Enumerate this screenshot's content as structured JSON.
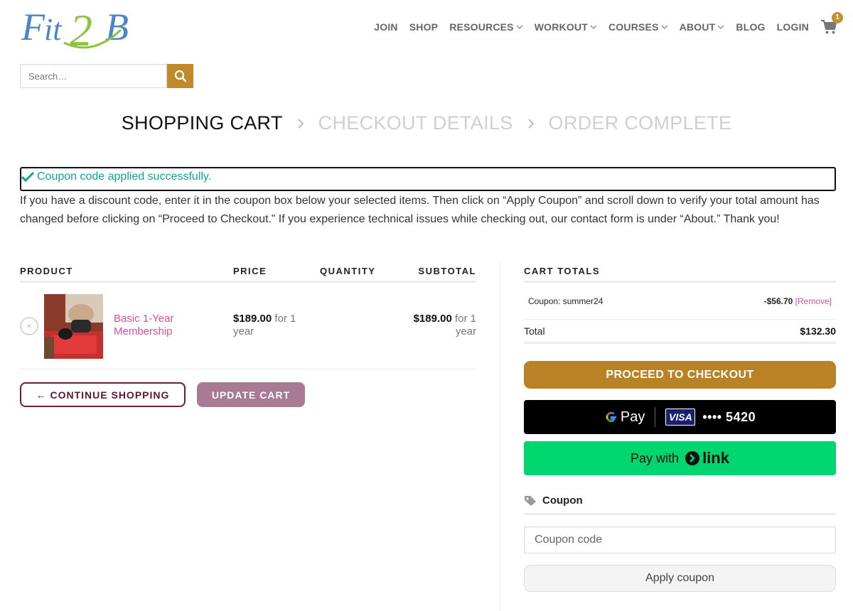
{
  "header": {
    "logo_text": "Fit2B",
    "nav": [
      {
        "label": "JOIN",
        "has_dropdown": false
      },
      {
        "label": "SHOP",
        "has_dropdown": false
      },
      {
        "label": "RESOURCES",
        "has_dropdown": true
      },
      {
        "label": "WORKOUT",
        "has_dropdown": true
      },
      {
        "label": "COURSES",
        "has_dropdown": true
      },
      {
        "label": "ABOUT",
        "has_dropdown": true
      },
      {
        "label": "BLOG",
        "has_dropdown": false
      },
      {
        "label": "LOGIN",
        "has_dropdown": false
      }
    ],
    "cart_count": "1",
    "cart_icon": "cart-icon"
  },
  "search": {
    "placeholder": "Search…",
    "icon": "search-icon"
  },
  "steps": [
    {
      "label": "SHOPPING CART",
      "active": true
    },
    {
      "label": "CHECKOUT DETAILS",
      "active": false
    },
    {
      "label": "ORDER COMPLETE",
      "active": false
    }
  ],
  "notice": {
    "text": "Coupon code applied successfully.",
    "icon": "check-icon",
    "color": "#11a58a"
  },
  "intro_text": "If you have a discount code, enter it in the coupon box below your selected items. Then click on “Apply Coupon” and scroll down to verify your total amount has changed before clicking on “Proceed to Checkout.” If you experience technical issues while checking out, our contact form is under “About.” Thank you!",
  "cart": {
    "headers": {
      "product": "PRODUCT",
      "price": "PRICE",
      "quantity": "QUANTITY",
      "subtotal": "SUBTOTAL"
    },
    "items": [
      {
        "name": "Basic 1-Year Membership",
        "price": "$189.00",
        "price_suffix": "for 1 year",
        "subtotal": "$189.00",
        "subtotal_suffix": "for 1 year",
        "remove_symbol": "×"
      }
    ],
    "continue_label": "← CONTINUE SHOPPING",
    "update_label": "UPDATE CART"
  },
  "totals": {
    "title": "CART TOTALS",
    "coupon_label": "Coupon: summer24",
    "coupon_amount": "-$56.70",
    "coupon_remove": "[Remove]",
    "total_label": "Total",
    "total_value": "$132.30",
    "checkout_label": "PROCEED TO CHECKOUT",
    "gpay": {
      "brand": "Pay",
      "card_brand": "VISA",
      "card_digits": "•••• 5420"
    },
    "link_pay": {
      "prefix": "Pay with",
      "brand": "link"
    },
    "coupon_section": {
      "title": "Coupon",
      "placeholder": "Coupon code",
      "apply_label": "Apply coupon"
    }
  },
  "colors": {
    "brand_gold": "#c08a2b",
    "brand_pink": "#d3519d",
    "brand_plum": "#6a1f3c",
    "link_green": "#00d66f"
  }
}
